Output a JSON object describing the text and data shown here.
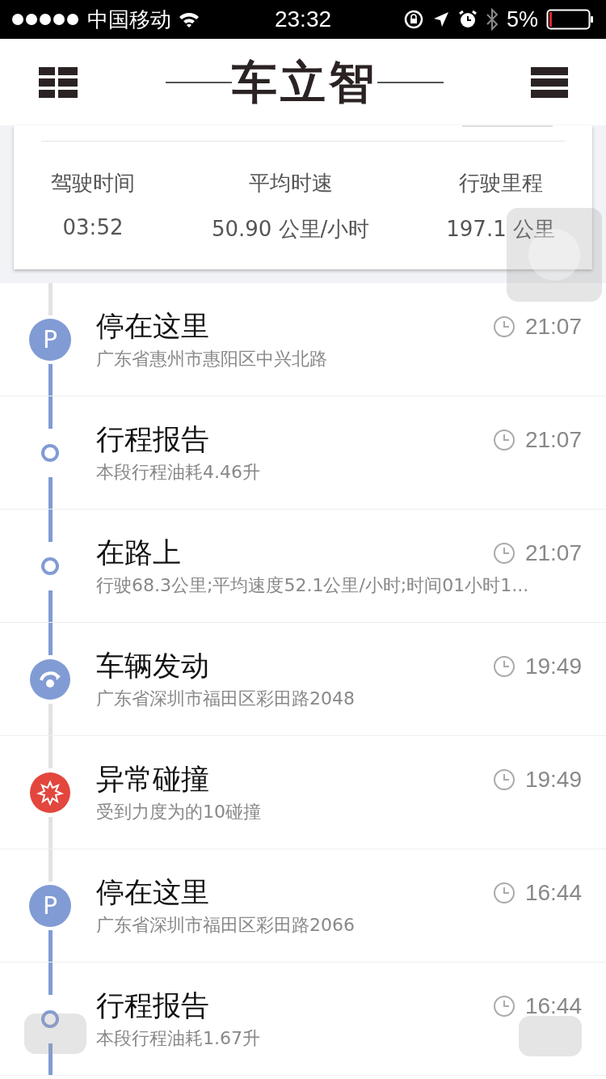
{
  "status_bar": {
    "carrier": "中国移动",
    "time": "23:32",
    "battery": "5%"
  },
  "header": {
    "title": "车立智"
  },
  "summary": {
    "stats": [
      {
        "label": "驾驶时间",
        "value": "03:52"
      },
      {
        "label": "平均时速",
        "value": "50.90 公里/小时"
      },
      {
        "label": "行驶里程",
        "value": "197.1 公里"
      }
    ]
  },
  "events": [
    {
      "kind": "parking",
      "icon_text": "P",
      "title": "停在这里",
      "detail": "广东省惠州市惠阳区中兴北路",
      "time": "21:07",
      "trip_before": false,
      "trip_after": true
    },
    {
      "kind": "report",
      "title": "行程报告",
      "detail": "本段行程油耗4.46升",
      "time": "21:07",
      "trip_before": true,
      "trip_after": true
    },
    {
      "kind": "report",
      "title": "在路上",
      "detail": "行驶68.3公里;平均速度52.1公里/小时;时间01小时1...",
      "time": "21:07",
      "trip_before": true,
      "trip_after": true
    },
    {
      "kind": "start",
      "title": "车辆发动",
      "detail": "广东省深圳市福田区彩田路2048",
      "time": "19:49",
      "trip_before": true,
      "trip_after": false
    },
    {
      "kind": "collision",
      "title": "异常碰撞",
      "detail": "受到力度为的10碰撞",
      "time": "19:49",
      "trip_before": false,
      "trip_after": false
    },
    {
      "kind": "parking",
      "icon_text": "P",
      "title": "停在这里",
      "detail": "广东省深圳市福田区彩田路2066",
      "time": "16:44",
      "trip_before": false,
      "trip_after": true
    },
    {
      "kind": "report",
      "title": "行程报告",
      "detail": "本段行程油耗1.67升",
      "time": "16:44",
      "trip_before": true,
      "trip_after": true
    }
  ]
}
